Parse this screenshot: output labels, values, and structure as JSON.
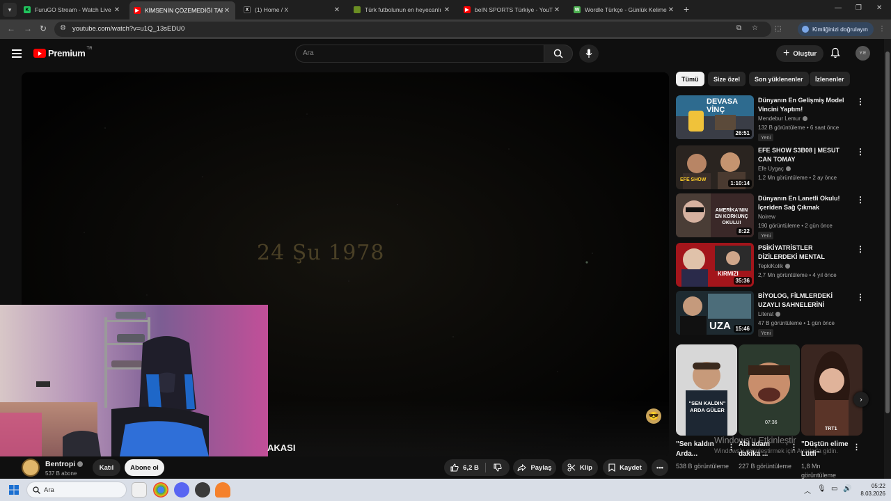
{
  "browser": {
    "tabs": [
      {
        "title": "FuruGO Stream - Watch Live on",
        "favicon_color": "#22c55e",
        "favicon_letter": "K",
        "active": false
      },
      {
        "title": "KİMSENİN ÇÖZEMEDİĞİ TARİHİ",
        "favicon_color": "#ff0000",
        "favicon_letter": "▶",
        "active": true
      },
      {
        "title": "(1) Home / X",
        "favicon_color": "#111111",
        "favicon_letter": "X",
        "active": false
      },
      {
        "title": "Türk futbolunun en heyecanlı m",
        "favicon_color": "#6b8e23",
        "favicon_letter": "",
        "active": false
      },
      {
        "title": "beIN SPORTS Türkiye - YouTube",
        "favicon_color": "#ff0000",
        "favicon_letter": "▶",
        "active": false
      },
      {
        "title": "Wordle Türkçe - Günlük Kelime",
        "favicon_color": "#4caf50",
        "favicon_letter": "W",
        "active": false
      }
    ],
    "url": "youtube.com/watch?v=u1Q_13sEDU0",
    "profile_label": "Kimliğinizi doğrulayın"
  },
  "youtube": {
    "logo_text": "Premium",
    "country_code": "TR",
    "search_placeholder": "Ara",
    "create_label": "Oluştur",
    "avatar_initials": "Y.E"
  },
  "player": {
    "caption_text": "24 Şu    1978",
    "title_fragment": "AKASI"
  },
  "channel": {
    "name": "Bentropi",
    "subscribers": "537 B abone",
    "join_label": "Katıl",
    "subscribe_label": "Abone ol"
  },
  "actions": {
    "likes": "6,2 B",
    "share_label": "Paylaş",
    "clip_label": "Klip",
    "save_label": "Kaydet"
  },
  "chips": [
    "Tümü",
    "Size özel",
    "Son yüklenenler",
    "İzlenenler"
  ],
  "recommendations": [
    {
      "title": "Dünyanın En Gelişmiş Model Vincini Yaptım!",
      "channel": "Mendebur Lemur",
      "meta": "132 B görüntüleme • 6 saat önce",
      "badge": "Yeni",
      "duration": "26:51",
      "thumb_text": "DEVASA VİNÇ"
    },
    {
      "title": "EFE SHOW S3B08 | MESUT CAN TOMAY",
      "channel": "Efe Uygaç",
      "meta": "1,2 Mn görüntüleme • 2 ay önce",
      "badge": "",
      "duration": "1:10:14",
      "thumb_text": "EFE SHOW"
    },
    {
      "title": "Dünyanın En Lanetli Okulu! İçeriden Sağ Çıkmak Neredeys...",
      "channel": "Noirew",
      "meta": "190 görüntüleme • 2 gün önce",
      "badge": "Yeni",
      "duration": "8:22",
      "thumb_text": "AMERİKA'NIN EN KORKUNÇ OKULU!"
    },
    {
      "title": "PSİKİYATRİSTLER DİZİLERDEKİ MENTAL RAHATSIZLIK ...",
      "channel": "TepkiKolik",
      "meta": "2,7 Mn görüntüleme • 4 yıl önce",
      "badge": "",
      "duration": "35:36",
      "thumb_text": "KIRMIZI"
    },
    {
      "title": "BİYOLOG, FİLMLERDEKİ UZAYLI SAHNELERİNİ YORUMLUYOR!",
      "channel": "Literat",
      "meta": "47 B görüntüleme • 1 gün önce",
      "badge": "Yeni",
      "duration": "15:46",
      "thumb_text": "UZA"
    }
  ],
  "shorts": [
    {
      "title": "\"Sen kaldın Arda...",
      "views": "538 B görüntüleme",
      "thumb_text": "\"SEN KALDIN\" ARDA GÜLER"
    },
    {
      "title": "Abi adam dakika ...",
      "views": "227 B görüntüleme",
      "thumb_text": "07:36"
    },
    {
      "title": "\"Düştün elime Lütfi\"",
      "views": "1,8 Mn görüntüleme",
      "thumb_text": "TRT1"
    }
  ],
  "watermark": {
    "line1": "Windows'u Etkinleştir",
    "line2": "Windows'u etkinleştirmek için Ayarlar'a gidin."
  },
  "taskbar": {
    "search_placeholder": "Ara",
    "time": "05:22",
    "date": "8.03.2026"
  }
}
